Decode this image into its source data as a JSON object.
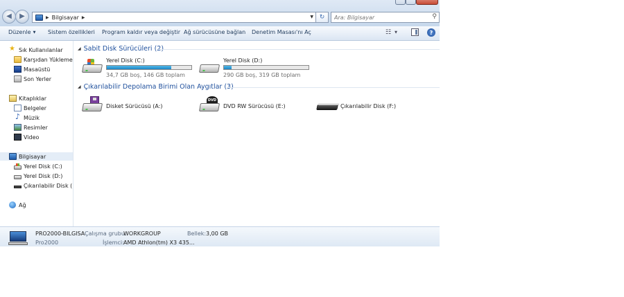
{
  "address": {
    "crumbs": [
      "Bilgisayar"
    ],
    "search_placeholder": "Ara: Bilgisayar"
  },
  "toolbar": {
    "organize": "Düzenle",
    "system_properties": "Sistem özellikleri",
    "uninstall": "Program kaldır veya değiştir",
    "map_drive": "Ağ sürücüsüne bağlan",
    "control_panel": "Denetim Masası'nı Aç"
  },
  "nav": {
    "favorites": "Sık Kullanılanlar",
    "downloads": "Karşıdan Yüklemeler",
    "desktop": "Masaüstü",
    "recent": "Son Yerler",
    "libraries": "Kitaplıklar",
    "documents": "Belgeler",
    "music": "Müzik",
    "pictures": "Resimler",
    "videos": "Video",
    "computer": "Bilgisayar",
    "drive_c": "Yerel Disk (C:)",
    "drive_d": "Yerel Disk (D:)",
    "drive_f": "Çıkarılabilir Disk (F:)",
    "network": "Ağ"
  },
  "groups": {
    "hdd": {
      "header": "Sabit Disk Sürücüleri (2)",
      "drives": [
        {
          "name": "Yerel Disk (C:)",
          "info": "34,7 GB boş, 146 GB toplam",
          "used_fraction": 0.76
        },
        {
          "name": "Yerel Disk (D:)",
          "info": "290 GB boş, 319 GB toplam",
          "used_fraction": 0.09
        }
      ]
    },
    "removable": {
      "header": "Çıkarılabilir Depolama Birimi Olan Aygıtlar (3)",
      "drives": [
        {
          "name": "Disket Sürücüsü (A:)"
        },
        {
          "name": "DVD RW Sürücüsü (E:)",
          "badge": "DVD"
        },
        {
          "name": "Çıkarılabilir Disk (F:)"
        }
      ]
    }
  },
  "details": {
    "computer_name": "PRO2000-BILGISA",
    "user": "Pro2000",
    "workgroup_label": "Çalışma grubu:",
    "workgroup": "WORKGROUP",
    "memory_label": "Bellek:",
    "memory": "3,00 GB",
    "processor_label": "İşlemci:",
    "processor": "AMD Athlon(tm) X3 435..."
  },
  "colors": {
    "header_text": "#1e4f9c",
    "bar_fill": "#1f86c4",
    "selection": "#e4edf7"
  }
}
